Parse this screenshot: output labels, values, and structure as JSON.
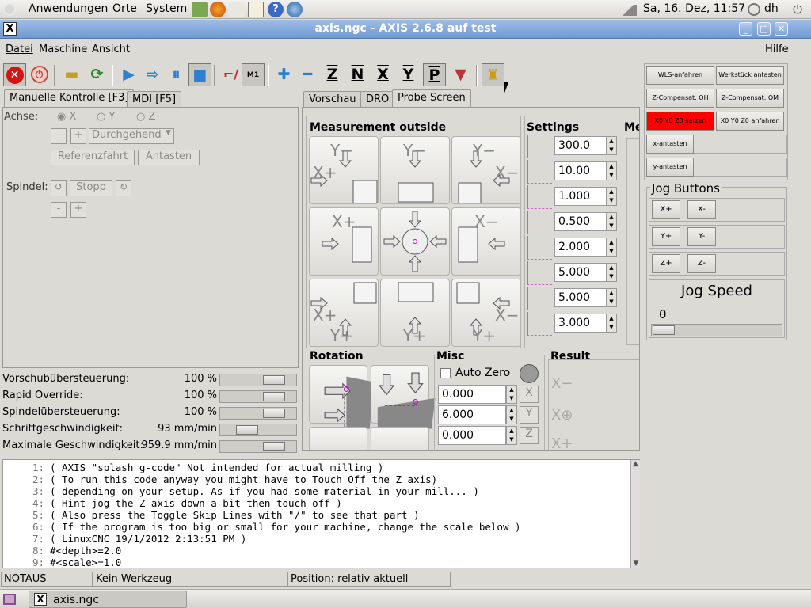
{
  "top_panel": {
    "menus": [
      "Anwendungen",
      "Orte",
      "System"
    ],
    "datetime": "Sa, 16. Dez, 11:57",
    "user": "dh"
  },
  "window": {
    "title": "axis.ngc - AXIS 2.6.8 auf  test",
    "close_x": "X"
  },
  "menubar": {
    "items": [
      "Datei",
      "Maschine",
      "Ansicht"
    ],
    "help": "Hilfe"
  },
  "toolbar": {
    "z": "Z",
    "n": "N",
    "x": "X",
    "y": "Y",
    "p": "P",
    "m1": "M1"
  },
  "left_tabs": [
    "Manuelle Kontrolle [F3]",
    "MDI [F5]"
  ],
  "manual": {
    "axis_label": "Achse:",
    "axes": [
      "X",
      "Y",
      "Z"
    ],
    "minus": "-",
    "plus": "+",
    "mode": "Durchgehend",
    "home_button": "Referenzfahrt",
    "touch_button": "Antasten",
    "spindle_label": "Spindel:",
    "stop_button": "Stopp"
  },
  "overrides": [
    {
      "label": "Vorschubübersteuerung:",
      "value": "100 %",
      "level": 0.79
    },
    {
      "label": "Rapid Override:",
      "value": "100 %",
      "level": 0.8
    },
    {
      "label": "Spindelübersteuerung:",
      "value": "100 %",
      "level": 0.79
    },
    {
      "label": "Schrittgeschwindigkeit:",
      "value": "93 mm/min",
      "level": 0.3
    },
    {
      "label": "Maximale Geschwindigkeit:",
      "value": "959.9 mm/min",
      "level": 0.8
    }
  ],
  "right_tabs": [
    "Vorschau",
    "DRO",
    "Probe Screen"
  ],
  "probe": {
    "measurement_title": "Measurement outside",
    "settings_title": "Settings",
    "third_title": "Me",
    "settings_values": [
      "300.0",
      "10.00",
      "1.000",
      "0.500",
      "2.000",
      "5.000",
      "5.000",
      "3.000"
    ],
    "rotation_title": "Rotation",
    "misc_title": "Misc",
    "auto_zero": "Auto Zero",
    "misc_values": [
      "0.000",
      "6.000",
      "0.000"
    ],
    "result_title": "Result"
  },
  "right_panel": {
    "buttons": [
      [
        "WLS-anfahren",
        "Werkstück antasten"
      ],
      [
        "Z-Compensat. OH",
        "Z-Compensat. OM"
      ],
      [
        "X0 Y0 Z0 setzen",
        "X0 Y0 Z0 anfahren"
      ]
    ],
    "single": [
      "x-antasten",
      "y-antasten"
    ],
    "jog_title": "Jog Buttons",
    "jog": [
      [
        "X+",
        "X-"
      ],
      [
        "Y+",
        "Y-"
      ],
      [
        "Z+",
        "Z-"
      ]
    ],
    "jog_speed_label": "Jog Speed",
    "jog_speed_value": "0",
    "highlight_color": "#ff0000"
  },
  "code_lines": [
    {
      "n": "1:",
      "t": "( AXIS \"splash g-code\" Not intended for actual milling )"
    },
    {
      "n": "2:",
      "t": "( To run this code anyway you might have to Touch Off the Z axis)"
    },
    {
      "n": "3:",
      "t": "( depending on your setup. As if you had some material in your mill... )"
    },
    {
      "n": "4:",
      "t": "( Hint jog the Z axis down a bit then touch off )"
    },
    {
      "n": "5:",
      "t": "( Also press the Toggle Skip Lines with \"/\" to see that part )"
    },
    {
      "n": "6:",
      "t": "( If the program is too big or small for your machine, change the scale below )"
    },
    {
      "n": "7:",
      "t": "( LinuxCNC 19/1/2012 2:13:51 PM )"
    },
    {
      "n": "8:",
      "t": "#<depth>=2.0"
    },
    {
      "n": "9:",
      "t": "#<scale>=1.0"
    }
  ],
  "status": {
    "estop": "NOTAUS",
    "tool": "Kein Werkzeug",
    "position": "Position: relativ aktuell"
  },
  "taskbar": {
    "item": "axis.ngc"
  }
}
